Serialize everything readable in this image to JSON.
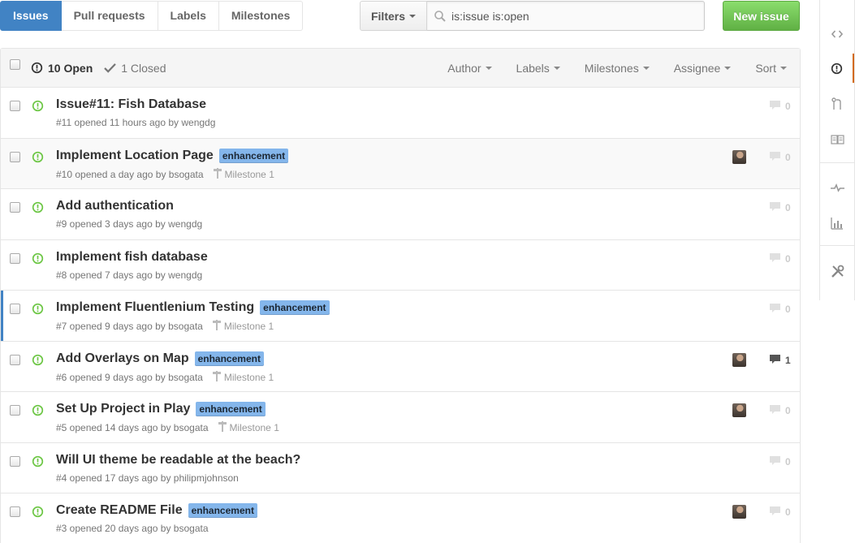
{
  "nav": {
    "tabs": [
      {
        "label": "Issues",
        "selected": true
      },
      {
        "label": "Pull requests",
        "selected": false
      },
      {
        "label": "Labels",
        "selected": false
      },
      {
        "label": "Milestones",
        "selected": false
      }
    ],
    "filters_label": "Filters",
    "search_value": "is:issue is:open",
    "new_issue_label": "New issue"
  },
  "header": {
    "open_label": "10 Open",
    "closed_label": "1 Closed",
    "filters": [
      "Author",
      "Labels",
      "Milestones",
      "Assignee",
      "Sort"
    ]
  },
  "issues": [
    {
      "title": "Issue#11: Fish Database",
      "label": "",
      "meta": "#11 opened 11 hours ago by",
      "author": "wengdg",
      "milestone": "",
      "avatar": false,
      "comments": "0"
    },
    {
      "title": "Implement Location Page",
      "label": "enhancement",
      "meta": "#10 opened a day ago by",
      "author": "bsogata",
      "milestone": "Milestone 1",
      "avatar": true,
      "comments": "0"
    },
    {
      "title": "Add authentication",
      "label": "",
      "meta": "#9 opened 3 days ago by",
      "author": "wengdg",
      "milestone": "",
      "avatar": false,
      "comments": "0"
    },
    {
      "title": "Implement fish database",
      "label": "",
      "meta": "#8 opened 7 days ago by",
      "author": "wengdg",
      "milestone": "",
      "avatar": false,
      "comments": "0"
    },
    {
      "title": "Implement Fluentlenium Testing",
      "label": "enhancement",
      "meta": "#7 opened 9 days ago by",
      "author": "bsogata",
      "milestone": "Milestone 1",
      "avatar": false,
      "comments": "0"
    },
    {
      "title": "Add Overlays on Map",
      "label": "enhancement",
      "meta": "#6 opened 9 days ago by",
      "author": "bsogata",
      "milestone": "Milestone 1",
      "avatar": true,
      "comments": "1"
    },
    {
      "title": "Set Up Project in Play",
      "label": "enhancement",
      "meta": "#5 opened 14 days ago by",
      "author": "bsogata",
      "milestone": "Milestone 1",
      "avatar": true,
      "comments": "0"
    },
    {
      "title": "Will UI theme be readable at the beach?",
      "label": "",
      "meta": "#4 opened 17 days ago by",
      "author": "philipmjohnson",
      "milestone": "",
      "avatar": false,
      "comments": "0"
    },
    {
      "title": "Create README File",
      "label": "enhancement",
      "meta": "#3 opened 20 days ago by",
      "author": "bsogata",
      "milestone": "",
      "avatar": true,
      "comments": "0"
    }
  ],
  "colors": {
    "accent": "#4183c4",
    "open_green": "#6cc644",
    "label_bg": "#84b6eb",
    "new_issue_green": "#60b044",
    "selected_nav": "#d26911"
  },
  "icons": {
    "search": "search-icon",
    "open_issue": "issue-opened-icon",
    "check": "check-icon",
    "milestone": "milestone-icon",
    "comment": "comment-icon"
  }
}
